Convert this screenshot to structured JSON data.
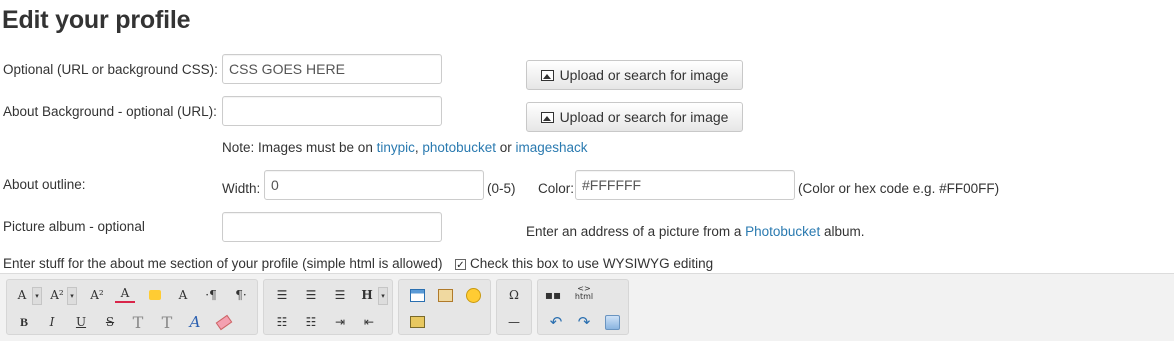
{
  "page": {
    "title": "Edit your profile"
  },
  "fields": {
    "background": {
      "label": "Optional (URL or background CSS):",
      "value": "CSS GOES HERE",
      "button": "Upload or search for image"
    },
    "about_background": {
      "label": "About Background - optional (URL):",
      "value": "",
      "button": "Upload or search for image"
    },
    "note": {
      "prefix": "Note: Images must be on",
      "link1": "tinypic",
      "sep1": ",",
      "link2": "photobucket",
      "sep2": "or",
      "link3": "imageshack"
    },
    "outline": {
      "label": "About outline:",
      "width_label": "Width:",
      "width_value": "0",
      "range": "(0-5)",
      "color_label": "Color:",
      "color_value": "#FFFFFF",
      "color_hint": "(Color or hex code e.g. #FF00FF)"
    },
    "picture_album": {
      "label": "Picture album - optional",
      "value": "",
      "hint_prefix": "Enter an address of a picture from a",
      "hint_link": "Photobucket",
      "hint_suffix": "album."
    },
    "about_me": {
      "label": "Enter stuff for the about me section of your profile (simple html is allowed)",
      "checkbox_label": "Check this box to use WYSIWYG editing",
      "checked": true
    }
  },
  "toolbar": {
    "row1": [
      "A",
      "A²",
      "A²",
      "A",
      "A",
      "¶",
      "¶",
      "≡",
      "≡",
      "≡",
      "H",
      "Ω"
    ],
    "row2": [
      "B",
      "I",
      "U",
      "S",
      "T",
      "T",
      "A"
    ],
    "html_label": "html"
  }
}
